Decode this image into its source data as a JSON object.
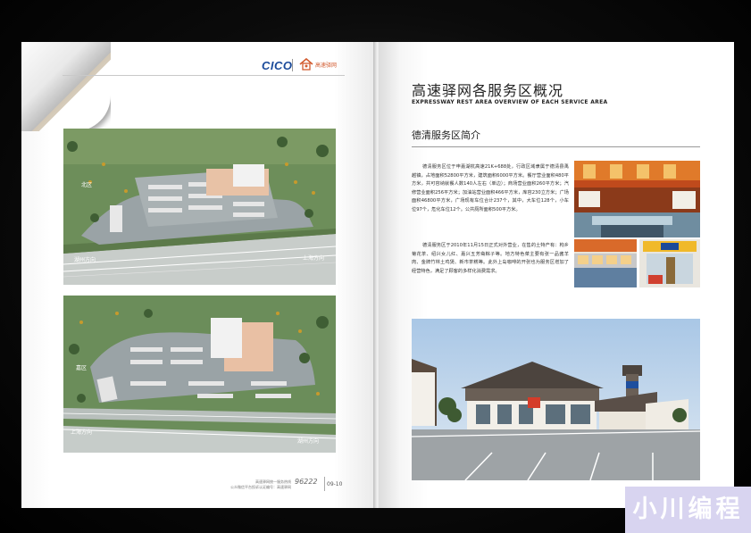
{
  "left_page": {
    "logo": {
      "cico": "CICO",
      "brand": "高速驿网"
    },
    "map_top": {
      "area_label": "北区",
      "entrance_label": "湖州方向",
      "exit_label": "上海方向"
    },
    "map_bottom": {
      "area_label": "嘉区",
      "entrance_label": "上海方向",
      "exit_label": "湖州方向"
    },
    "footer": {
      "line1": "高速驿网统一服务热线",
      "line2": "公众微信平台投诉认证编号：高速驿网",
      "phone": "96222",
      "pages": "09-10"
    }
  },
  "right_page": {
    "title": "高速驿网各服务区概况",
    "subtitle": "EXPRESSWAY REST AREA OVERVIEW OF EACH SERVICE AREA",
    "section_title": "德清服务区简介",
    "paragraphs": [
      "德清服务区位于申嘉湖杭高速21K+688处，行政区域隶属于德清县禹越镇，占地面积52800平方米，建筑面积6000平方米。餐厅营业面积480平方米，共可容纳就餐人数140人左右（单边）；商场营业面积260平方米；汽修营业面积256平方米；加油站营业面积466平方米，库容230立方米；广场面积46800平方米，广场现有车位合计237个，其中，大车位128个，小车位97个，危化车位12个。公共厕所面积500平方米。",
      "德清服务区于2010年11月15日正式对外营业，在售的土特产有：枸乡菊花茶、绍兴女儿红、嘉兴五芳斋粽子等。地方特色菜主要有张一品酱羊肉、金牌竹林土鸡煲、新市茶糕等。此外上岛咖啡的开张也为服务区增加了经营特色，满足了顾客的多样化消费需求。"
    ]
  },
  "watermark": {
    "text": "小川编程"
  },
  "colors": {
    "background": "#000000",
    "logo_blue": "#1a4a9a",
    "logo_orange": "#d25a2e",
    "map_green": "#6c8d5b",
    "road_gray": "#9aa3a6",
    "watermark_bg": "#d8d4f0"
  }
}
